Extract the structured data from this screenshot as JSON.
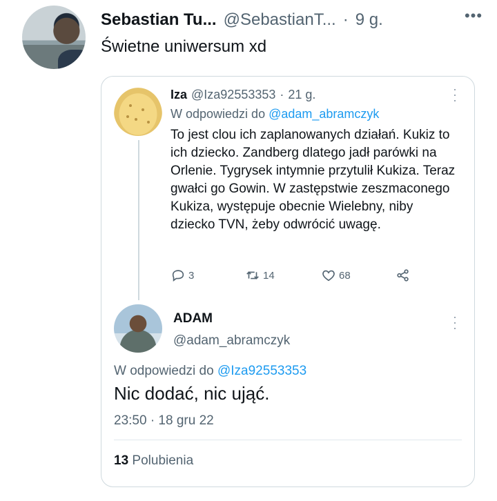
{
  "outer": {
    "author_name": "Sebastian Tu...",
    "author_handle": "@SebastianT...",
    "separator": "·",
    "time": "9 g.",
    "more_glyph": "•••",
    "text": "Świetne uniwersum xd"
  },
  "quoted": {
    "author_name": "Iza",
    "author_handle": "@Iza92553353",
    "separator": "·",
    "time": "21 g.",
    "reply_prefix": "W odpowiedzi do",
    "reply_to": "@adam_abramczyk",
    "body": "To jest clou ich zaplanowanych działań. Kukiz to ich dziecko. Zandberg dlatego jadł parówki na Orlenie. Tygrysek intymnie przytulił Kukiza. Teraz gwałci go Gowin. W zastępstwie zeszmaconego Kukiza, występuje obecnie Wielebny, niby dziecko TVN, żeby odwrócić uwagę.",
    "actions": {
      "replies": "3",
      "retweets": "14",
      "likes": "68"
    }
  },
  "reply": {
    "author_name": "ADAM",
    "author_handle": "@adam_abramczyk",
    "reply_prefix": "W odpowiedzi do",
    "reply_to": "@Iza92553353",
    "text": "Nic dodać, nic ująć.",
    "date": "23:50 · 18 gru 22",
    "likes_count": "13",
    "likes_label": "Polubienia"
  },
  "colors": {
    "accent": "#1d9bf0",
    "secondary_text": "#536471",
    "border": "#cfd9de"
  }
}
